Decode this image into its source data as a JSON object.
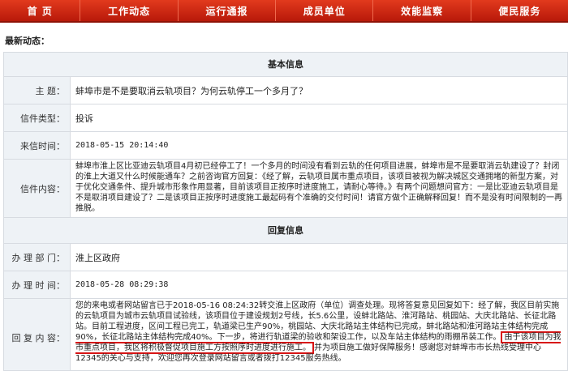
{
  "nav": {
    "items": [
      "首 页",
      "工作动态",
      "运行通报",
      "成员单位",
      "效能监察",
      "便民服务"
    ]
  },
  "section_title": "最新动态：",
  "basic": {
    "heading": "基本信息",
    "subject_label": "主    题：",
    "subject_value": "蚌埠市是不是要取消云轨项目？为何云轨停工一个多月了？",
    "type_label": "信件类型：",
    "type_value": "投诉",
    "time_label": "来信时间：",
    "time_value": "2018-05-15 20:14:40",
    "content_label": "信件内容：",
    "content_value": "蚌埠市淮上区比亚迪云轨项目4月初已经停工了！一个多月的时间没有看到云轨的任何项目进展，蚌埠市是不是要取消云轨建设了？封闭的淮上大道又什么时候能通车？之前咨询官方回复：《经了解，云轨项目属市重点项目，该项目被视为解决城区交通拥堵的新型方案，对于优化交通条件、提升城市形象作用显著，目前该项目正按序时进度施工，请耐心等待。》有两个问题想问官方：一是比亚迪云轨项目是不是取消项目建设了？二是该项目正按序时进度施工最起码有个准确的交付时间！请官方做个正确解释回复！而不是没有时间限制的一再推脱。"
  },
  "reply": {
    "heading": "回复信息",
    "dept_label": "办 理 部 门：",
    "dept_value": "淮上区政府",
    "time_label": "办 理 时 间：",
    "time_value": "2018-05-28 08:29:38",
    "content_label": "回 复 内 容：",
    "content_before": "您的来电或者网站留言已于2018-05-16 08:24:32转交淮上区政府（单位）调查处理。现将答复意见回复如下：经了解，我区目前实施的云轨项目为城市云轨项目试验线，该项目位于建设规划2号线，长5.6公里，设蚌北路站、淮河路站、桃园站、大庆北路站、长征北路站。目前工程进度，区间工程已完工，轨道梁已生产90%，桃园站、大庆北路站主体结构已完成，蚌北路站和淮河路站主体结构完成90%，长征北路站主体结构完成40%。下一步，将进行轨道梁的验收和架设工作，以及车站主体结构的雨棚吊装工作。",
    "content_highlight": "由于该项目为我市重点项目，我区将积极督促项目施工方按照序时进度进行施工。",
    "content_after": "并为项目施工做好保障服务！感谢您对蚌埠市市长热线受理中心12345的关心与支持，欢迎您再次登录网站留言或者拨打12345服务热线。"
  }
}
